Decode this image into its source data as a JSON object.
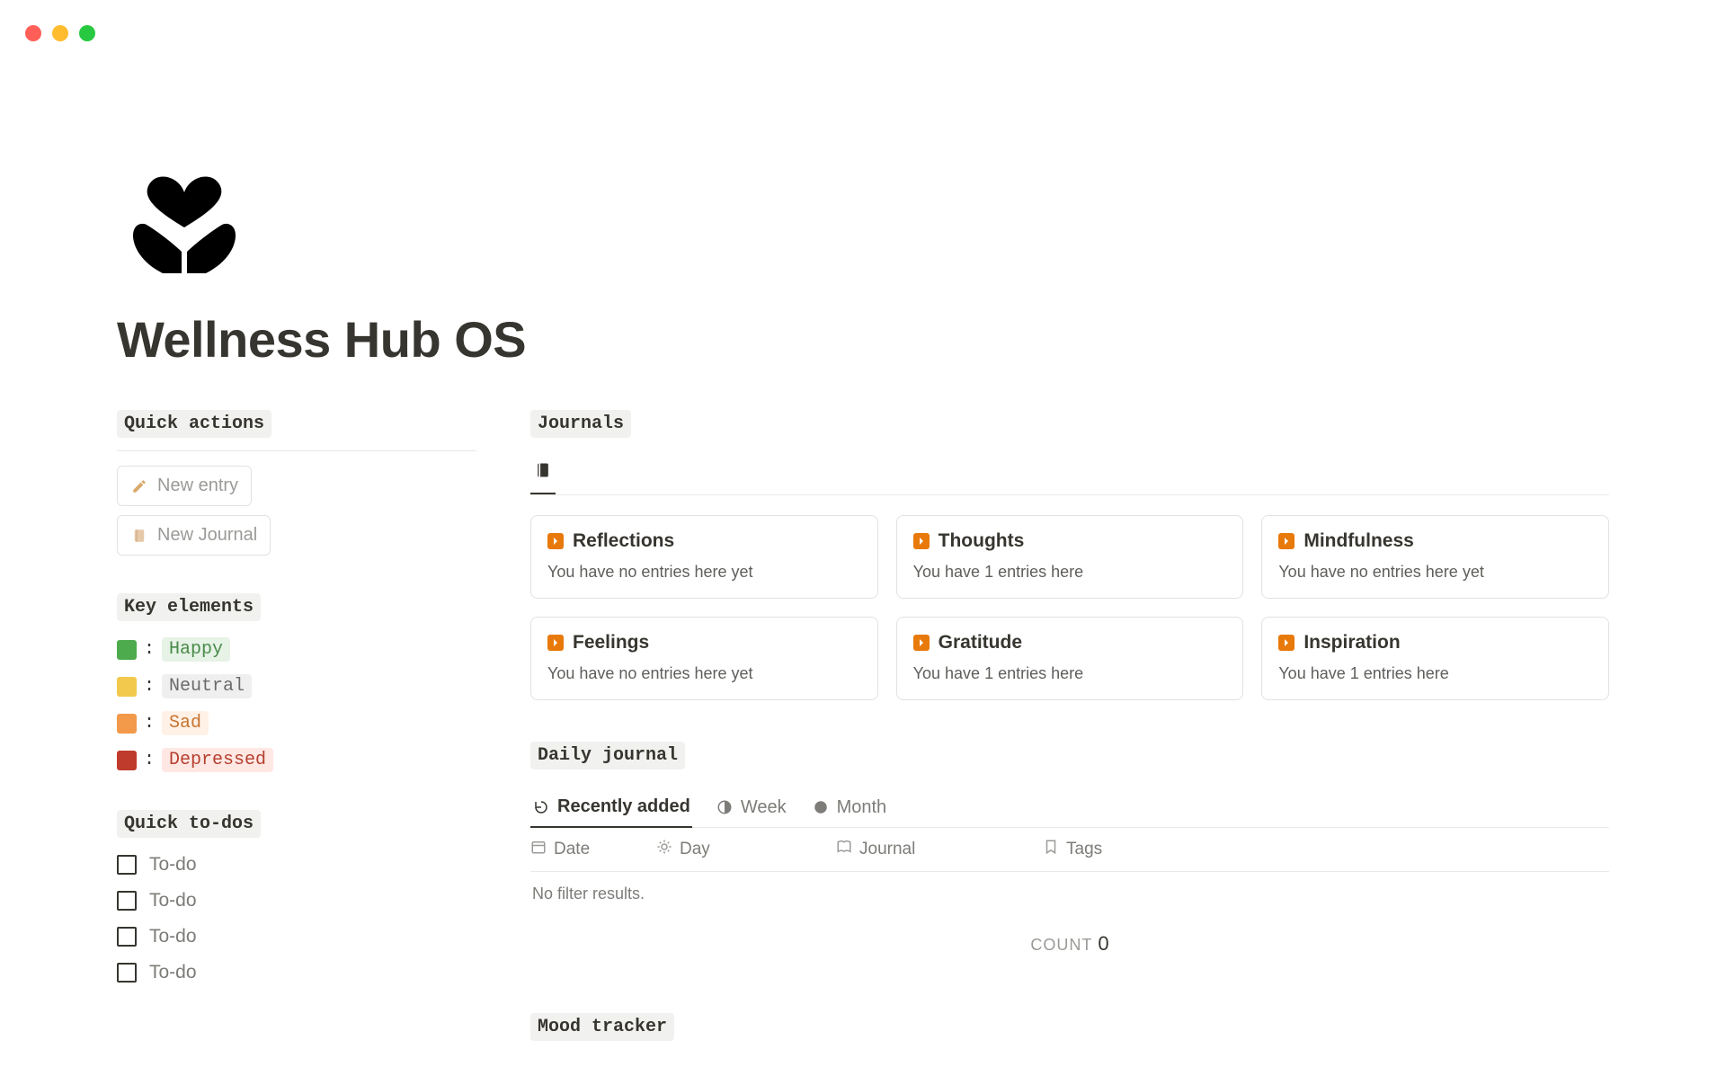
{
  "page": {
    "title": "Wellness Hub OS"
  },
  "quick_actions": {
    "heading": "Quick actions",
    "items": [
      {
        "label": "New entry"
      },
      {
        "label": "New Journal"
      }
    ]
  },
  "key_elements": {
    "heading": "Key elements",
    "items": [
      {
        "swatch": "#4dab4d",
        "label": "Happy",
        "label_bg": "#e6f3e6",
        "label_color": "#4a8a4a"
      },
      {
        "swatch": "#f2c94c",
        "label": "Neutral",
        "label_bg": "#efefef",
        "label_color": "#6b6b6b"
      },
      {
        "swatch": "#f2994a",
        "label": "Sad",
        "label_bg": "#fff1e6",
        "label_color": "#c77430"
      },
      {
        "swatch": "#bf3b2c",
        "label": "Depressed",
        "label_bg": "#ffe8e4",
        "label_color": "#b5402f"
      }
    ]
  },
  "quick_todos": {
    "heading": "Quick to-dos",
    "items": [
      "To-do",
      "To-do",
      "To-do",
      "To-do"
    ]
  },
  "journals": {
    "heading": "Journals",
    "cards": [
      {
        "title": "Reflections",
        "sub": "You have no entries here yet"
      },
      {
        "title": "Thoughts",
        "sub": "You have 1 entries here"
      },
      {
        "title": "Mindfulness",
        "sub": "You have no entries here yet"
      },
      {
        "title": "Feelings",
        "sub": "You have no entries here yet"
      },
      {
        "title": "Gratitude",
        "sub": "You have 1 entries here"
      },
      {
        "title": "Inspiration",
        "sub": "You have 1 entries here"
      }
    ]
  },
  "daily_journal": {
    "heading": "Daily journal",
    "tabs": [
      {
        "label": "Recently added",
        "active": true
      },
      {
        "label": "Week",
        "active": false
      },
      {
        "label": "Month",
        "active": false
      }
    ],
    "columns": {
      "date": "Date",
      "day": "Day",
      "journal": "Journal",
      "tags": "Tags"
    },
    "empty": "No filter results.",
    "count_label": "COUNT",
    "count_value": "0"
  },
  "mood_tracker": {
    "heading": "Mood tracker"
  }
}
